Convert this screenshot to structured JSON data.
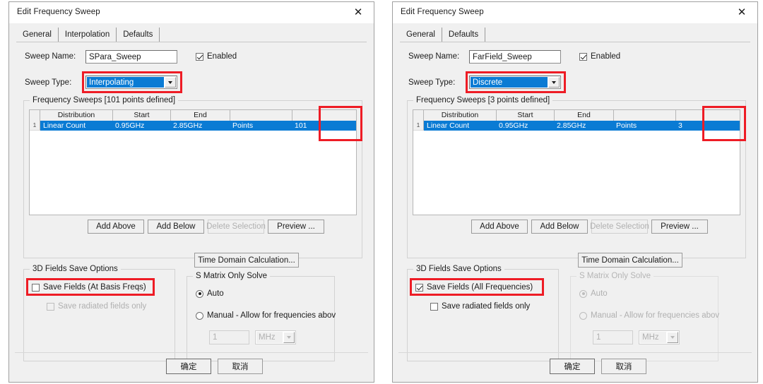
{
  "dialogs": [
    {
      "title": "Edit Frequency Sweep",
      "close_icon": "close-icon",
      "tabs": [
        {
          "label": "General",
          "selected": true
        },
        {
          "label": "Interpolation",
          "selected": false
        },
        {
          "label": "Defaults",
          "selected": false
        }
      ],
      "sweep_name_label": "Sweep Name:",
      "sweep_name_value": "SPara_Sweep",
      "enabled_label": "Enabled",
      "enabled_checked": true,
      "sweep_type_label": "Sweep Type:",
      "sweep_type_value": "Interpolating",
      "freq_group_title": "Frequency Sweeps [101 points defined]",
      "grid": {
        "columns": [
          "Distribution",
          "Start",
          "End",
          "",
          ""
        ],
        "rows": [
          {
            "index": "1",
            "cells": [
              "Linear Count",
              "0.95GHz",
              "2.85GHz",
              "Points",
              "101"
            ]
          }
        ]
      },
      "grid_buttons": [
        {
          "label": "Add Above",
          "disabled": false
        },
        {
          "label": "Add Below",
          "disabled": false
        },
        {
          "label": "Delete Selection",
          "disabled": true
        },
        {
          "label": "Preview ...",
          "disabled": false
        }
      ],
      "fields_group_title": "3D Fields Save Options",
      "save_fields_label": "Save Fields (At Basis Freqs)",
      "save_fields_checked": false,
      "save_fields_disabled": false,
      "save_radiated_label": "Save radiated fields only",
      "save_radiated_checked": false,
      "save_radiated_disabled": true,
      "time_domain_button": "Time Domain Calculation...",
      "smatrix_group_title": "S Matrix Only Solve",
      "smatrix_disabled": false,
      "auto_label": "Auto",
      "auto_selected": true,
      "manual_label": "Manual -  Allow for frequencies abov",
      "manual_selected": false,
      "manual_value": "1",
      "manual_unit": "MHz",
      "ok_button": "确定",
      "cancel_button": "取消"
    },
    {
      "title": "Edit Frequency Sweep",
      "close_icon": "close-icon",
      "tabs": [
        {
          "label": "General",
          "selected": true
        },
        {
          "label": "Defaults",
          "selected": false
        }
      ],
      "sweep_name_label": "Sweep Name:",
      "sweep_name_value": "FarField_Sweep",
      "enabled_label": "Enabled",
      "enabled_checked": true,
      "sweep_type_label": "Sweep Type:",
      "sweep_type_value": "Discrete",
      "freq_group_title": "Frequency Sweeps [3 points defined]",
      "grid": {
        "columns": [
          "Distribution",
          "Start",
          "End",
          "",
          ""
        ],
        "rows": [
          {
            "index": "1",
            "cells": [
              "Linear Count",
              "0.95GHz",
              "2.85GHz",
              "Points",
              "3"
            ]
          }
        ]
      },
      "grid_buttons": [
        {
          "label": "Add Above",
          "disabled": false
        },
        {
          "label": "Add Below",
          "disabled": false
        },
        {
          "label": "Delete Selection",
          "disabled": true
        },
        {
          "label": "Preview ...",
          "disabled": false
        }
      ],
      "fields_group_title": "3D Fields Save Options",
      "save_fields_label": "Save Fields (All Frequencies)",
      "save_fields_checked": true,
      "save_fields_disabled": false,
      "save_radiated_label": "Save radiated fields only",
      "save_radiated_checked": false,
      "save_radiated_disabled": false,
      "time_domain_button": "Time Domain Calculation...",
      "smatrix_group_title": "S Matrix Only Solve",
      "smatrix_disabled": true,
      "auto_label": "Auto",
      "auto_selected": true,
      "manual_label": "Manual -  Allow for frequencies abov",
      "manual_selected": false,
      "manual_value": "1",
      "manual_unit": "MHz",
      "ok_button": "确定",
      "cancel_button": "取消"
    }
  ],
  "colors": {
    "accent": "#0a7bd4",
    "annotation": "#ee1c25",
    "dialog_bg": "#f0f0f0"
  }
}
